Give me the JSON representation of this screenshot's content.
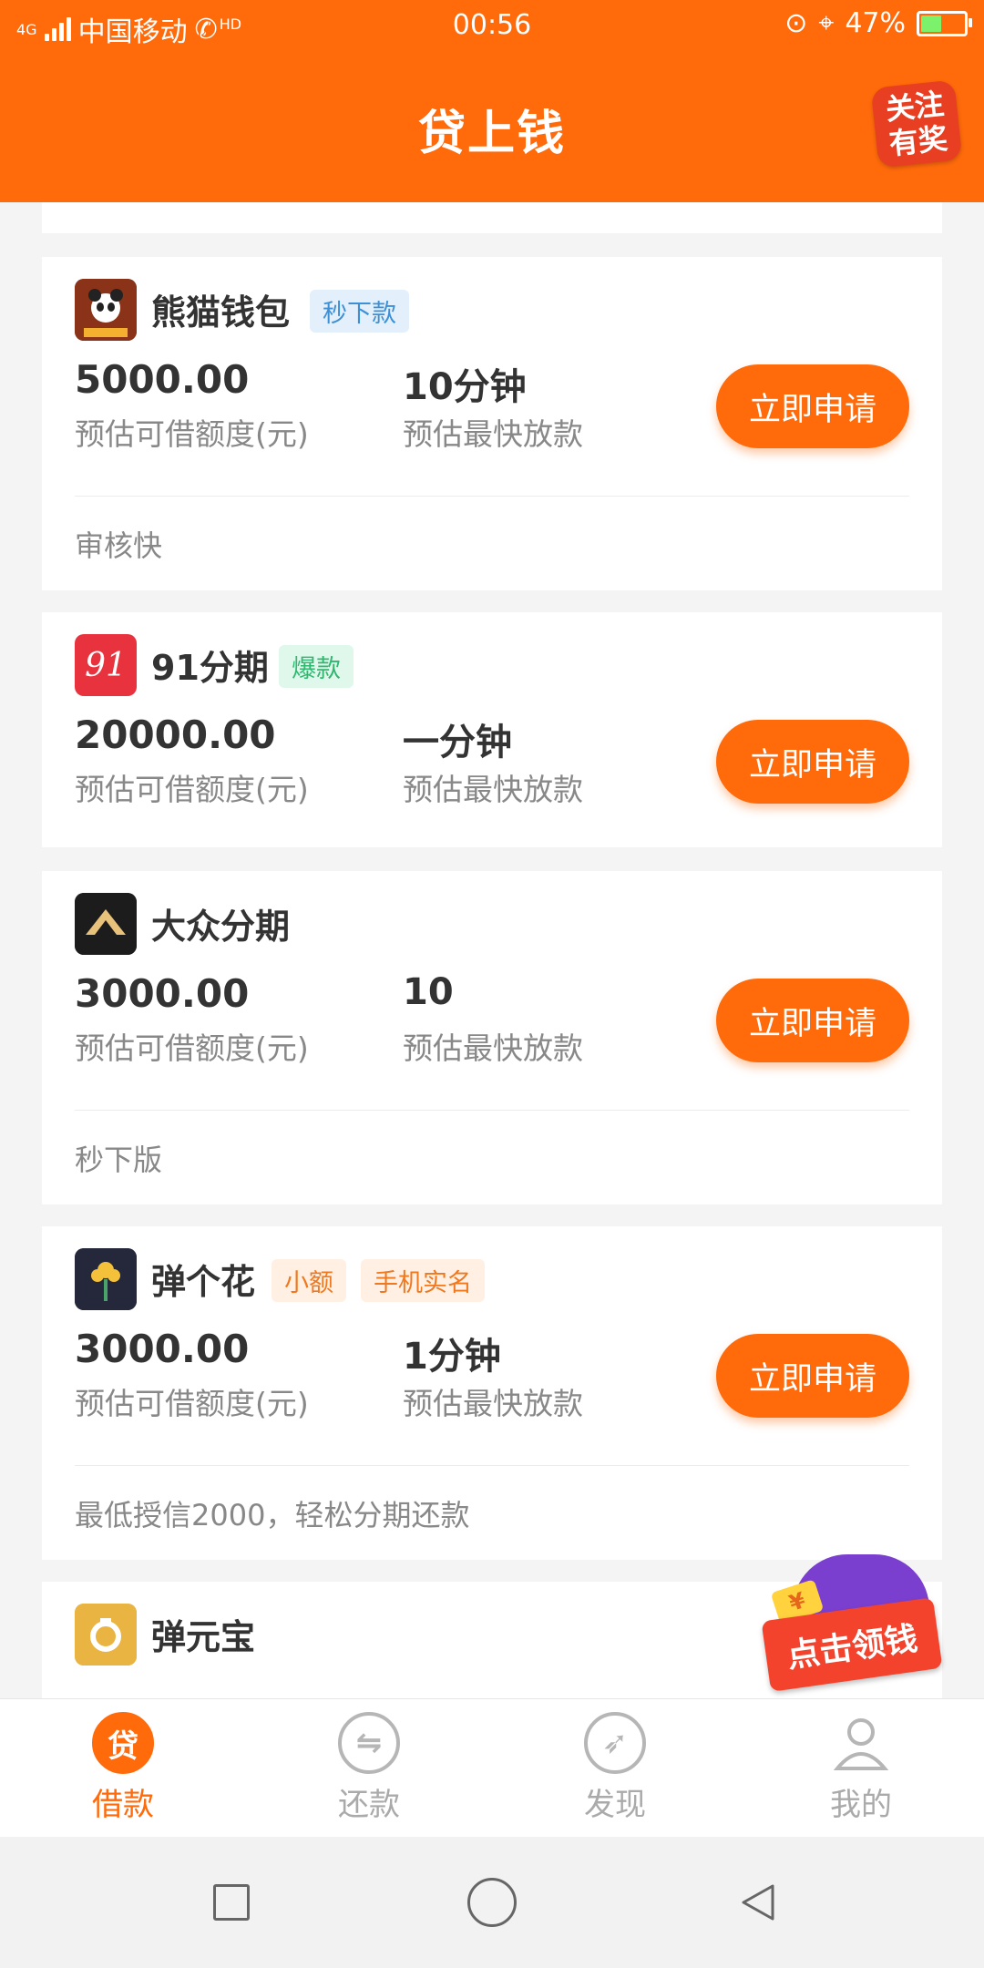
{
  "status_bar": {
    "network": "4G",
    "carrier": "中国移动",
    "hd": "HD",
    "time": "00:56",
    "battery": "47%"
  },
  "header": {
    "title": "贷上钱",
    "promo_line1": "关注",
    "promo_line2": "有奖"
  },
  "loans": [
    {
      "name": "熊猫钱包",
      "tags": [
        "秒下款"
      ],
      "amount": "5000.00",
      "amount_label": "预估可借额度(元)",
      "time": "10分钟",
      "time_label": "预估最快放款",
      "apply": "立即申请",
      "note": "审核快",
      "logo_color": "#7a2e14"
    },
    {
      "name": "91分期",
      "tags": [
        "爆款"
      ],
      "amount": "20000.00",
      "amount_label": "预估可借额度(元)",
      "time": "一分钟",
      "time_label": "预估最快放款",
      "apply": "立即申请",
      "note": "",
      "logo_color": "#e8333f",
      "logo_text": "91"
    },
    {
      "name": "大众分期",
      "tags": [],
      "amount": "3000.00",
      "amount_label": "预估可借额度(元)",
      "time": "10",
      "time_label": "预估最快放款",
      "apply": "立即申请",
      "note": "秒下版",
      "logo_color": "#1c1c1c"
    },
    {
      "name": "弹个花",
      "tags": [
        "小额",
        "手机实名"
      ],
      "amount": "3000.00",
      "amount_label": "预估可借额度(元)",
      "time": "1分钟",
      "time_label": "预估最快放款",
      "apply": "立即申请",
      "note": "最低授信2000，轻松分期还款",
      "logo_color": "#25283a"
    },
    {
      "name": "弹元宝",
      "tags": [],
      "logo_color": "#e9b441"
    }
  ],
  "float_promo": {
    "label": "点击领钱",
    "coin": "¥"
  },
  "bottom_nav": [
    {
      "label": "借款",
      "icon": "loan-icon",
      "glyph": "贷",
      "active": true
    },
    {
      "label": "还款",
      "icon": "repay-icon",
      "glyph": "⇋",
      "active": false
    },
    {
      "label": "发现",
      "icon": "discover-icon",
      "glyph": "➶",
      "active": false
    },
    {
      "label": "我的",
      "icon": "profile-icon",
      "glyph": "",
      "active": false
    }
  ],
  "colors": {
    "accent": "#ff6a0b",
    "background": "#f4f4f4"
  }
}
